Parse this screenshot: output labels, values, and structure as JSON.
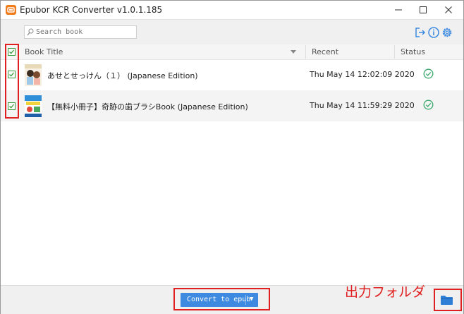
{
  "window": {
    "title": "Epubor KCR Converter v1.0.1.185",
    "minimize_glyph": "—",
    "maximize_glyph": "☐",
    "close_glyph": "✕"
  },
  "toolbar": {
    "search_placeholder": "Search book",
    "icons": [
      "logout-icon",
      "info-icon",
      "settings-gear-icon"
    ]
  },
  "table": {
    "columns": [
      "Book Title",
      "Recent",
      "Status"
    ],
    "rows": [
      {
        "title": "あせとせっけん（１） (Japanese Edition)",
        "recent": "Thu May 14 12:02:09 2020",
        "status": "done-check-icon",
        "checked": true
      },
      {
        "title": "【無料小冊子】奇跡の歯ブラシBook (Japanese Edition)",
        "recent": "Thu May 14 11:59:29 2020",
        "status": "done-check-icon",
        "checked": true
      }
    ]
  },
  "footer": {
    "convert_label": "Convert to epub",
    "dropdown_glyph": "▼"
  },
  "annotation": {
    "text": "出力フォルダ"
  },
  "colors": {
    "accent": "#3d8ae0",
    "brand": "#f07c1b",
    "check_green": "#3aa86b",
    "annotation_red": "#e02020"
  }
}
